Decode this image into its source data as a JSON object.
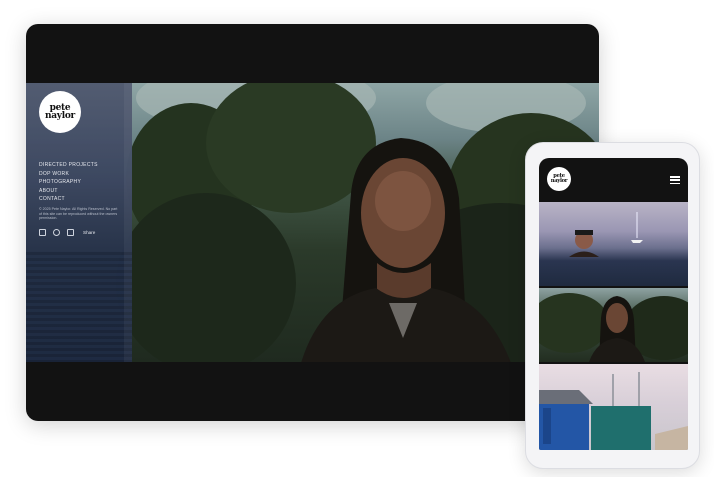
{
  "brand": {
    "logo_line1": "pete",
    "logo_line2": "naylor"
  },
  "desktop": {
    "nav": [
      {
        "label": "DIRECTED PROJECTS"
      },
      {
        "label": "DOP WORK"
      },
      {
        "label": "PHOTOGRAPHY"
      },
      {
        "label": "ABOUT"
      },
      {
        "label": "CONTACT"
      }
    ],
    "copyright": "© 2025 Pete Naylor. All Rights Reserved. No part of this site can be reproduced without the owners permission.",
    "social_icons": [
      "facebook-icon",
      "instagram-icon",
      "email-icon"
    ],
    "share_label": "Share"
  },
  "phone": {
    "menu_icon": "hamburger-icon"
  },
  "colors": {
    "frame_dark": "#121212",
    "sidebar": "#3c4761",
    "page_bg": "#ffffff"
  }
}
